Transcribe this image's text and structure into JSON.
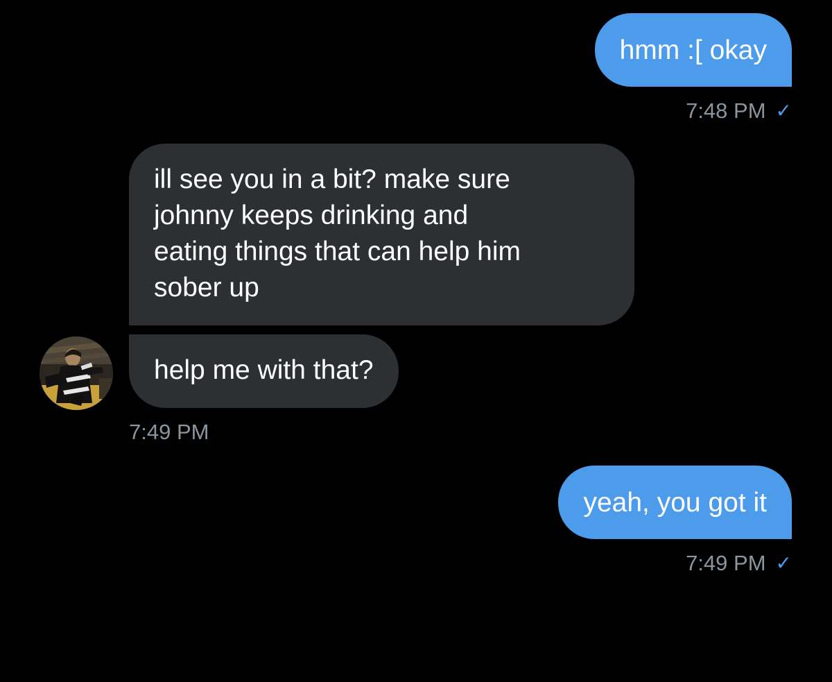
{
  "messages": [
    {
      "direction": "sent",
      "text": "hmm :[ okay"
    },
    {
      "direction": "sent",
      "time": "7:48 PM",
      "status_icon": "read-check-icon"
    },
    {
      "direction": "received",
      "text": "ill see you in a bit? make sure\njohnny keeps drinking and\neating things that can help him\nsober up"
    },
    {
      "direction": "received",
      "text": "help me with that?"
    },
    {
      "direction": "received",
      "time": "7:49 PM"
    },
    {
      "direction": "sent",
      "text": "yeah, you got it"
    },
    {
      "direction": "sent",
      "time": "7:49 PM",
      "status_icon": "read-check-icon"
    }
  ],
  "colors": {
    "background": "#000000",
    "sent_bubble": "#4c9ceb",
    "received_bubble": "#2d3033",
    "timestamp": "#8b959e",
    "check": "#4c9ceb"
  },
  "icons": {
    "check": "✓"
  }
}
